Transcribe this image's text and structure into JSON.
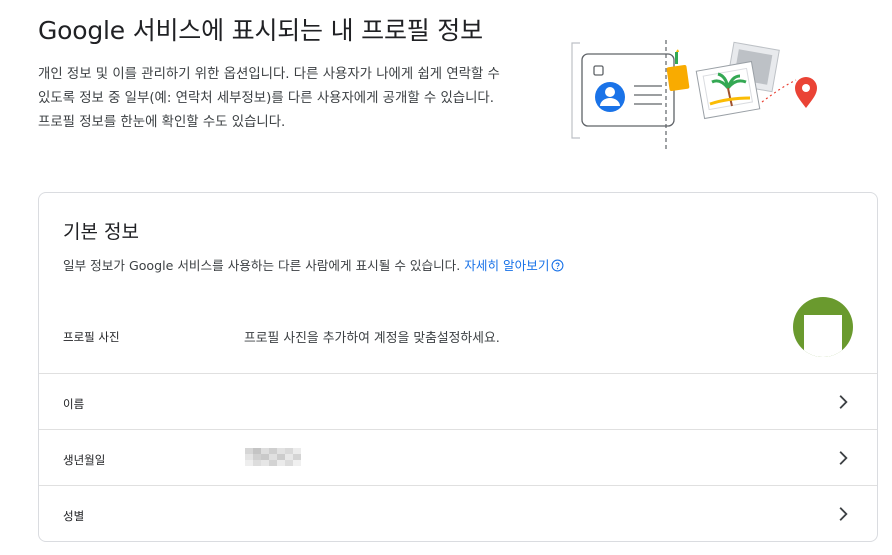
{
  "hero": {
    "title": "Google 서비스에 표시되는 내 프로필 정보",
    "description": "개인 정보 및 이를 관리하기 위한 옵션입니다. 다른 사용자가 나에게 쉽게 연락할 수 있도록 정보 중 일부(예: 연락처 세부정보)를 다른 사용자에게 공개할 수 있습니다. 프로필 정보를 한눈에 확인할 수도 있습니다."
  },
  "basic_info": {
    "title": "기본 정보",
    "description": "일부 정보가 Google 서비스를 사용하는 다른 사람에게 표시될 수 있습니다.",
    "learn_more": "자세히 알아보기",
    "rows": [
      {
        "label": "프로필 사진",
        "value": "프로필 사진을 추가하여 계정을 맞춤설정하세요."
      },
      {
        "label": "이름",
        "value": ""
      },
      {
        "label": "생년월일",
        "value": ""
      },
      {
        "label": "성별",
        "value": ""
      }
    ]
  },
  "colors": {
    "link": "#1a73e8",
    "avatar_bg": "#6a9a2e",
    "border": "#dadce0"
  },
  "icons": {
    "help": "help-circle-icon",
    "chevron": "chevron-right-icon"
  }
}
